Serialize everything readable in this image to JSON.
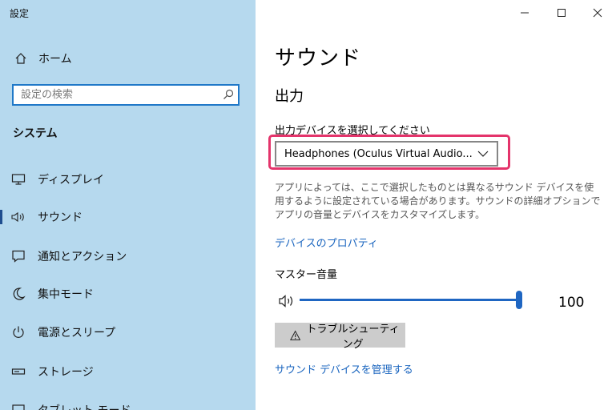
{
  "app": {
    "title": "設定"
  },
  "sidebar": {
    "home_label": "ホーム",
    "search_placeholder": "設定の検索",
    "section_title": "システム",
    "items": [
      {
        "label": "ディスプレイ",
        "icon": "monitor-icon"
      },
      {
        "label": "サウンド",
        "icon": "speaker-icon",
        "active": true
      },
      {
        "label": "通知とアクション",
        "icon": "notification-icon"
      },
      {
        "label": "集中モード",
        "icon": "moon-icon"
      },
      {
        "label": "電源とスリープ",
        "icon": "power-icon"
      },
      {
        "label": "ストレージ",
        "icon": "storage-icon"
      },
      {
        "label": "タブレット モード",
        "icon": "tablet-icon"
      }
    ]
  },
  "main": {
    "title": "サウンド",
    "output_heading": "出力",
    "device_label": "出力デバイスを選択してください",
    "device_value": "Headphones (Oculus Virtual Audio...",
    "description": "アプリによっては、ここで選択したものとは異なるサウンド デバイスを使用するように設定されている場合があります。サウンドの詳細オプションでアプリの音量とデバイスをカスタマイズします。",
    "device_properties_link": "デバイスのプロパティ",
    "master_volume_label": "マスター音量",
    "master_volume_value": "100",
    "troubleshoot_label": "トラブルシューティング",
    "manage_devices_link": "サウンド デバイスを管理する"
  },
  "colors": {
    "sidebar_bg": "#b6d9ee",
    "accent": "#1f66c2",
    "highlight": "#e4346b",
    "link": "#1a65bf"
  }
}
